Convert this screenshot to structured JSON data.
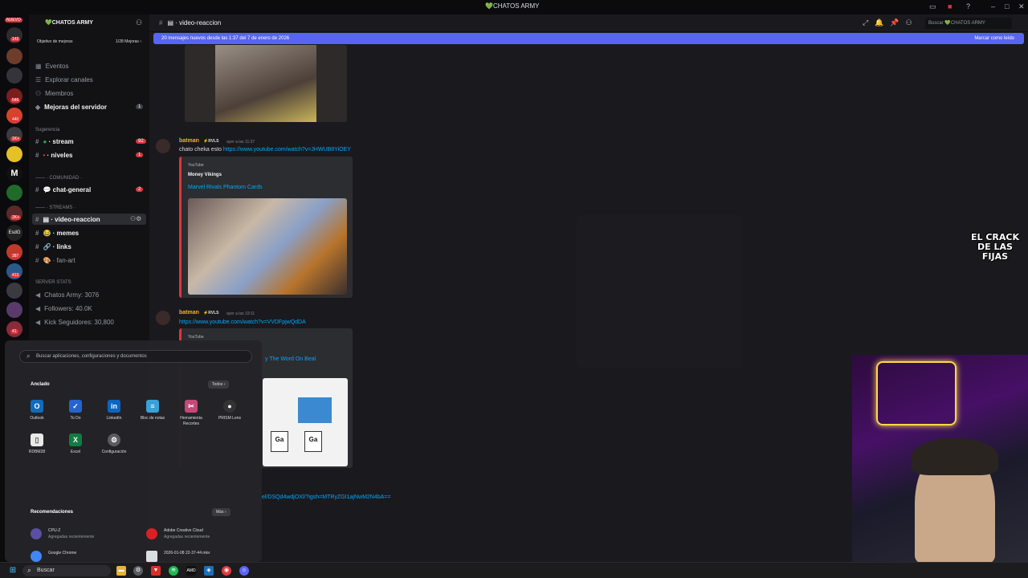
{
  "titlebar": {
    "title": "💚CHATOS ARMY"
  },
  "server": {
    "name": "💚CHATOS ARMY",
    "boost_goal": "Objetivo de mejoras",
    "boost_count": "1/28 Mejoras ›",
    "badge_new": "NUEVO"
  },
  "sidebar": {
    "top_items": [
      {
        "label": "Eventos"
      },
      {
        "label": "Explorar canales"
      },
      {
        "label": "Miembros"
      },
      {
        "label": "Mejoras del servidor",
        "badge": "1"
      }
    ],
    "categories": [
      {
        "label": "Sugerencia"
      },
      {
        "label": "—— · COMUNIDAD ·"
      },
      {
        "label": "—— · STREAMS ·"
      },
      {
        "label": "SERVER STATS"
      }
    ],
    "channels": [
      {
        "label": "stream",
        "badge": "92"
      },
      {
        "label": "niveles",
        "badge": "1"
      },
      {
        "label": "chat-general",
        "badge": "2"
      },
      {
        "label": "video-reaccion"
      },
      {
        "label": "memes"
      },
      {
        "label": "links"
      },
      {
        "label": "fan-art"
      }
    ],
    "stats": [
      {
        "label": "Chatos Army: 3076"
      },
      {
        "label": "Followers: 40.0K"
      },
      {
        "label": "Kick Seguidores: 30,800"
      }
    ]
  },
  "header": {
    "channel": "video-reaccion",
    "search_placeholder": "Buscar 💚CHATOS ARMY"
  },
  "banner": {
    "text": "20 mensajes nuevos desde las 1:37 del 7 de enero de 2026",
    "action": "Marcar como leído"
  },
  "messages": [
    {
      "author": "batman",
      "tag": "⚡RVLS",
      "time": "ayer a las 11:37",
      "text_prefix": "chato cheka esto ",
      "link": "https://www.youtube.com/watch?v=JHWUB8YiOEY",
      "embed": {
        "provider": "YouTube",
        "author": "Money Vikings",
        "title": "Marvel Rivals Phantom Cards"
      }
    },
    {
      "author": "batman",
      "tag": "⚡RVLS",
      "time": "ayer a las 19:11",
      "link": "https://www.youtube.com/watch?v=VVDFpjwQdDA",
      "embed": {
        "provider": "YouTube",
        "title_partial": "y The Word On Beal"
      }
    }
  ],
  "partial_link": "el/DSQd4wdjOXl/?igsh=MTRyZGI1ajNwM2N4bA==",
  "logo_text": "EL CRACK DE LAS FIJAS",
  "startmenu": {
    "search_placeholder": "Buscar aplicaciones, configuraciones y documentos",
    "pinned_title": "Anclado",
    "pinned_all": "Todos ›",
    "pinned": [
      {
        "label": "Outlook",
        "icon": "outlook-icon",
        "color": "#0f6cbd"
      },
      {
        "label": "To Do",
        "icon": "todo-icon",
        "color": "#2564cf"
      },
      {
        "label": "LinkedIn",
        "icon": "linkedin-icon",
        "color": "#0a66c2"
      },
      {
        "label": "Bloc de notas",
        "icon": "notepad-icon",
        "color": "#3aa0d8"
      },
      {
        "label": "Herramienta Recortes",
        "icon": "snipping-icon",
        "color": "#c5487a"
      },
      {
        "label": "PRISM Lens",
        "icon": "prism-icon",
        "color": "#333333"
      },
      {
        "label": "RDBM28",
        "icon": "file-icon",
        "color": "#e9e9e9"
      },
      {
        "label": "Excel",
        "icon": "excel-icon",
        "color": "#107c41"
      },
      {
        "label": "Configuración",
        "icon": "settings-icon",
        "color": "#5b5b63"
      }
    ],
    "rec_title": "Recomendaciones",
    "rec_more": "Más ›",
    "recommendations": [
      {
        "title": "CPU-Z",
        "sub": "Agregadas recientemente"
      },
      {
        "title": "Adobe Creative Cloud",
        "sub": "Agregadas recientemente"
      },
      {
        "title": "Google Chrome",
        "sub": ""
      },
      {
        "title": "2026-01-08 22-37-44.mkv",
        "sub": ""
      }
    ]
  },
  "taskbar": {
    "search": "Buscar"
  }
}
